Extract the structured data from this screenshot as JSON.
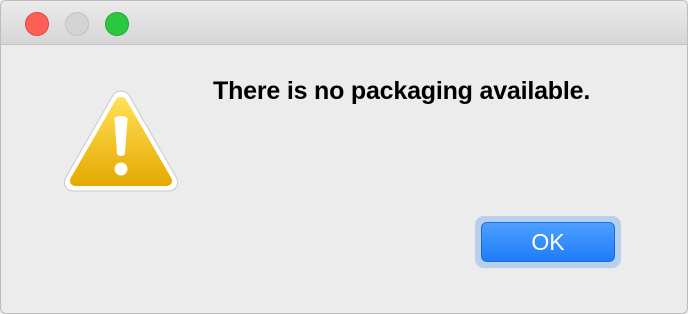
{
  "dialog": {
    "message": "There is no packaging available.",
    "ok_label": "OK",
    "icon": "warning-triangle-icon"
  },
  "window_controls": {
    "close_color": "#fe5f57",
    "minimize_color": "#d4d4d4",
    "zoom_color": "#2bc840"
  },
  "colors": {
    "accent": "#1e7cf8",
    "warning": "#f5c400"
  }
}
